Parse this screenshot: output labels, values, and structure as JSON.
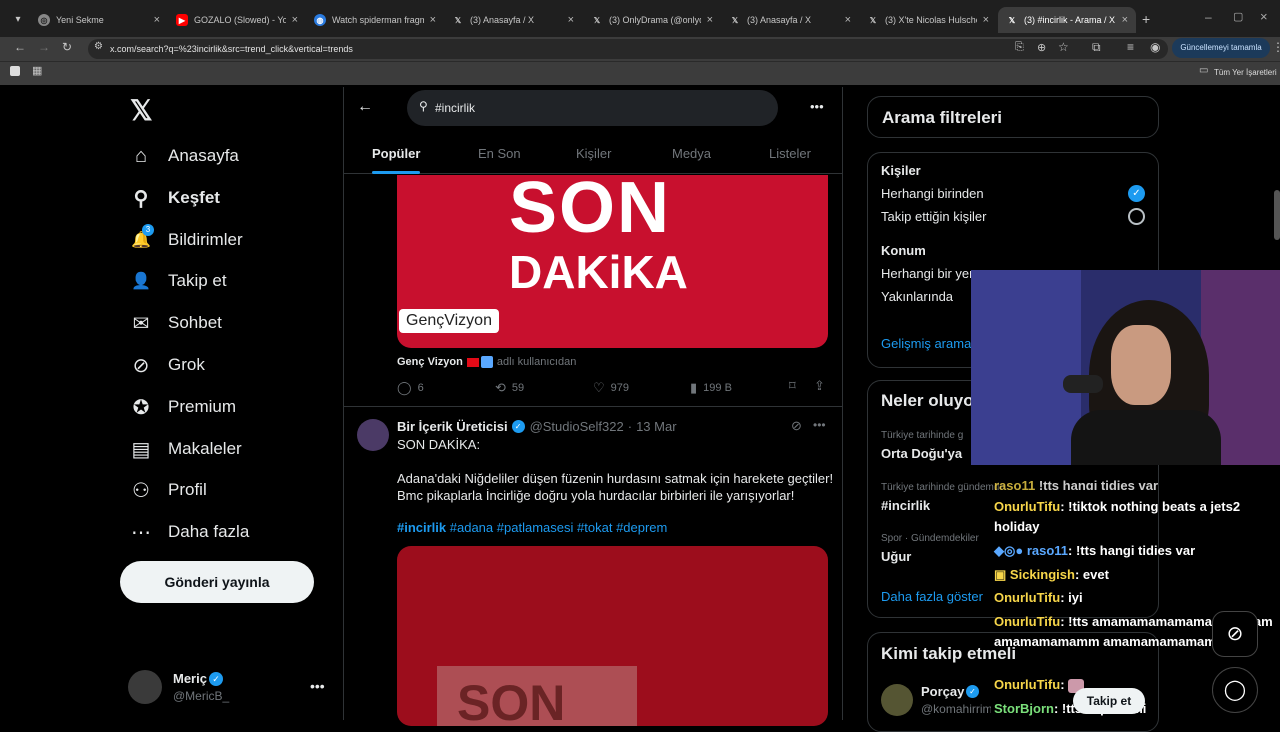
{
  "browser": {
    "tabs": [
      {
        "title": "Yeni Sekme",
        "icon": "chrome-icon"
      },
      {
        "title": "GOZALO (Slowed) - YouTube",
        "icon": "youtube-icon"
      },
      {
        "title": "Watch spiderman fragman",
        "icon": "globe-icon"
      },
      {
        "title": "(3) Anasayfa / X",
        "icon": "x-icon"
      },
      {
        "title": "(3) OnlyDrama (@onlydrama)",
        "icon": "x-icon"
      },
      {
        "title": "(3) Anasayfa / X",
        "icon": "x-icon"
      },
      {
        "title": "(3) X'te Nicolas Hulscher,",
        "icon": "x-icon"
      },
      {
        "title": "(3) #incirlik - Arama / X",
        "icon": "x-icon"
      }
    ],
    "url": "x.com/search?q=%23incirlik&src=trend_click&vertical=trends",
    "update_label": "Güncellemeyi tamamla",
    "bookmarks_label": "Tüm Yer İşaretleri"
  },
  "sidebar": {
    "logo": "𝕏",
    "items": [
      {
        "label": "Anasayfa",
        "icon": "home-icon",
        "glyph": "⌂"
      },
      {
        "label": "Keşfet",
        "icon": "search-icon",
        "glyph": "⚲"
      },
      {
        "label": "Bildirimler",
        "icon": "bell-icon",
        "glyph": "🔔"
      },
      {
        "label": "Takip et",
        "icon": "follow-icon",
        "glyph": "👤"
      },
      {
        "label": "Sohbet",
        "icon": "mail-icon",
        "glyph": "✉"
      },
      {
        "label": "Grok",
        "icon": "grok-icon",
        "glyph": "⊘"
      },
      {
        "label": "Premium",
        "icon": "premium-icon",
        "glyph": "✪"
      },
      {
        "label": "Makaleler",
        "icon": "articles-icon",
        "glyph": "▤"
      },
      {
        "label": "Profil",
        "icon": "profile-icon",
        "glyph": "⚇"
      },
      {
        "label": "Daha fazla",
        "icon": "more-icon",
        "glyph": "⋯"
      }
    ],
    "notif_count": "3",
    "post_button": "Gönderi yayınla",
    "account_name": "Meriç",
    "account_handle": "@MericB_"
  },
  "search": {
    "query": "#incirlik"
  },
  "tabs": [
    "Popüler",
    "En Son",
    "Kişiler",
    "Medya",
    "Listeler"
  ],
  "post1": {
    "image_text_1": "SON",
    "image_text_2": "DAKiKA",
    "image_caption": "GençVizyon",
    "author": "Genç Vizyon",
    "author_suffix": "adlı kullanıcıdan",
    "replies": "6",
    "reposts": "59",
    "likes": "979",
    "views": "199 B"
  },
  "post2": {
    "author": "Bir İçerik Üreticisi",
    "handle": "@StudioSelf322",
    "date": "13 Mar",
    "line1": "SON DAKİKA:",
    "line2": "Adana'daki Niğdeliler düşen füzenin hurdasını satmak için harekete geçtiler!",
    "line3": "Bmc pikaplarla İncirliğe doğru yola hurdacılar birbirleri ile yarışıyorlar!",
    "hashtags": [
      "#incirlik",
      "#adana",
      "#patlamasesi",
      "#tokat",
      "#deprem"
    ],
    "image_text": "SON"
  },
  "filters": {
    "title": "Arama filtreleri",
    "people_heading": "Kişiler",
    "people_any": "Herhangi birinden",
    "people_following": "Takip ettiğin kişiler",
    "location_heading": "Konum",
    "location_any": "Herhangi bir yer",
    "location_near": "Yakınlarında",
    "advanced": "Gelişmiş arama"
  },
  "trends": {
    "title": "Neler oluyor",
    "items": [
      {
        "context": "Türkiye tarihinde g",
        "name": "Orta Doğu'ya"
      },
      {
        "context": "Türkiye tarihinde gündemde",
        "name": "#incirlik"
      },
      {
        "context": "Spor · Gündemdekiler",
        "name": "Uğur"
      }
    ],
    "show_more": "Daha fazla göster"
  },
  "who_to_follow": {
    "title": "Kimi takip etmeli",
    "name": "Porçay",
    "handle": "@komahirrim",
    "follow": "Takip et"
  },
  "chat": [
    {
      "user": "OnurluTifu",
      "msg": ": !tiktok nothing beats a jets2 holiday"
    },
    {
      "user": "raso11",
      "msg": ": !tts hangi tidies var"
    },
    {
      "user": "Sickingish",
      "msg": ": evet"
    },
    {
      "user": "OnurluTifu",
      "msg": ": iyi"
    },
    {
      "user": "OnurluTifu",
      "msg": ": !tts amamamamamamamammamamamamamamm amamamamamamamam"
    },
    {
      "user": "OnurluTifu",
      "msg": ":"
    },
    {
      "user": "StorBjorn",
      "msg": ": !tts kapadnmi"
    }
  ],
  "colors": {
    "accent": "#1d9bf0",
    "bg": "#000000",
    "border": "#2f3336",
    "media_red": "#c8102e"
  }
}
